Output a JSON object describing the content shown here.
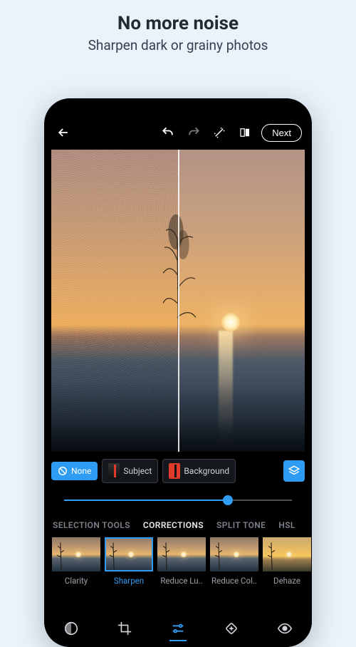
{
  "promo": {
    "title": "No more noise",
    "subtitle": "Sharpen dark or grainy photos"
  },
  "toolbar": {
    "next_label": "Next"
  },
  "masks": {
    "none_label": "None",
    "subject_label": "Subject",
    "background_label": "Background"
  },
  "slider": {
    "value_pct": 72
  },
  "tabs": {
    "items": [
      {
        "label": "SELECTION TOOLS"
      },
      {
        "label": "CORRECTIONS"
      },
      {
        "label": "SPLIT TONE"
      },
      {
        "label": "HSL"
      }
    ],
    "active": 1
  },
  "presets": {
    "items": [
      {
        "label": "Clarity"
      },
      {
        "label": "Sharpen"
      },
      {
        "label": "Reduce Lu.."
      },
      {
        "label": "Reduce Col.."
      },
      {
        "label": "Dehaze"
      }
    ],
    "active": 1
  },
  "colors": {
    "accent": "#2f9cf4"
  }
}
